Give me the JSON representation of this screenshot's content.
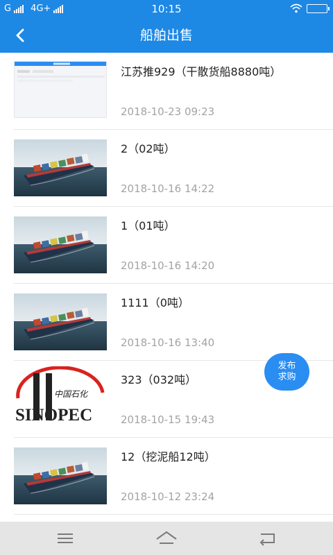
{
  "status_bar": {
    "carrier1": "G",
    "carrier2": "4G+",
    "time": "10:15"
  },
  "header": {
    "title": "船舶出售"
  },
  "listings": [
    {
      "title": "江苏推929（干散货船8880吨）",
      "date": "2018-10-23 09:23",
      "thumb": "screenshot"
    },
    {
      "title": "2（02吨）",
      "date": "2018-10-16 14:22",
      "thumb": "container-ship"
    },
    {
      "title": "1（01吨）",
      "date": "2018-10-16 14:20",
      "thumb": "container-ship"
    },
    {
      "title": "1111（0吨）",
      "date": "2018-10-16 13:40",
      "thumb": "container-ship"
    },
    {
      "title": "323（032吨）",
      "date": "2018-10-15 19:43",
      "thumb": "sinopec-logo"
    },
    {
      "title": "12（挖泥船12吨）",
      "date": "2018-10-12 23:24",
      "thumb": "container-ship"
    }
  ],
  "fab": {
    "line1": "发布",
    "line2": "求购"
  },
  "logo_text": {
    "chinese": "中国石化",
    "brand": "SINOPEC"
  },
  "colors": {
    "primary": "#1e88e5",
    "fab": "#2a8df1",
    "date_text": "#a3a3a3",
    "nav_bar": "#e5e5e5"
  },
  "icons": {
    "back": "chevron-left-icon",
    "menu": "menu-icon",
    "home": "home-icon",
    "return": "return-icon"
  }
}
